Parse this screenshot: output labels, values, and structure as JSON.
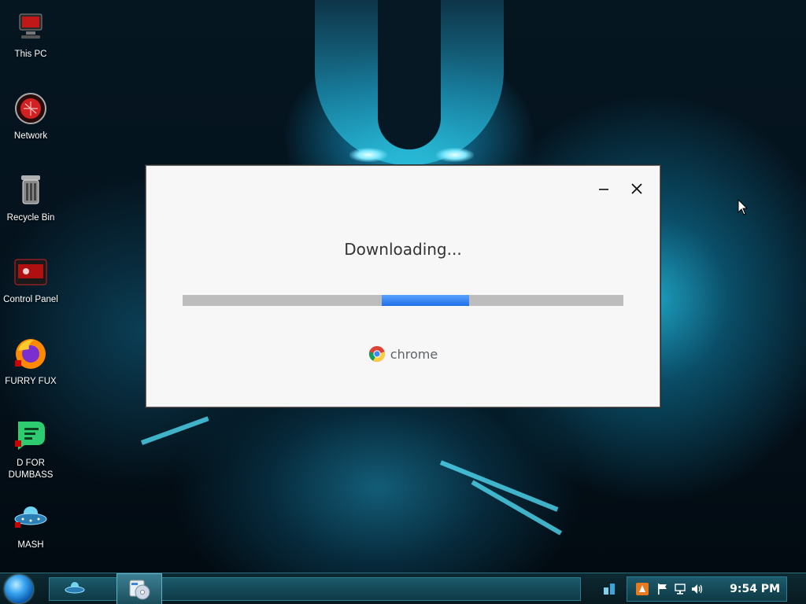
{
  "desktop_icons": [
    {
      "label": "This PC",
      "icon": "this-pc-icon"
    },
    {
      "label": "Network",
      "icon": "network-icon"
    },
    {
      "label": "Recycle Bin",
      "icon": "recycle-bin-icon"
    },
    {
      "label": "Control Panel",
      "icon": "control-panel-icon"
    },
    {
      "label": "FURRY FUX",
      "icon": "firefox-icon"
    },
    {
      "label": "D FOR\nDUMBASS",
      "icon": "chat-app-icon"
    },
    {
      "label": "MASH",
      "icon": "ufo-icon"
    }
  ],
  "dialog": {
    "status_text": "Downloading...",
    "brand_text": "chrome",
    "progress_indeterminate": true,
    "accent_color": "#1f70e6"
  },
  "taskbar": {
    "clock": "9:54 PM",
    "pinned": [
      "ufo-app-icon",
      "media-player-icon"
    ],
    "tray_icons": [
      "show-desktop-icon",
      "security-icon",
      "flag-icon",
      "network-tray-icon",
      "volume-icon"
    ]
  }
}
